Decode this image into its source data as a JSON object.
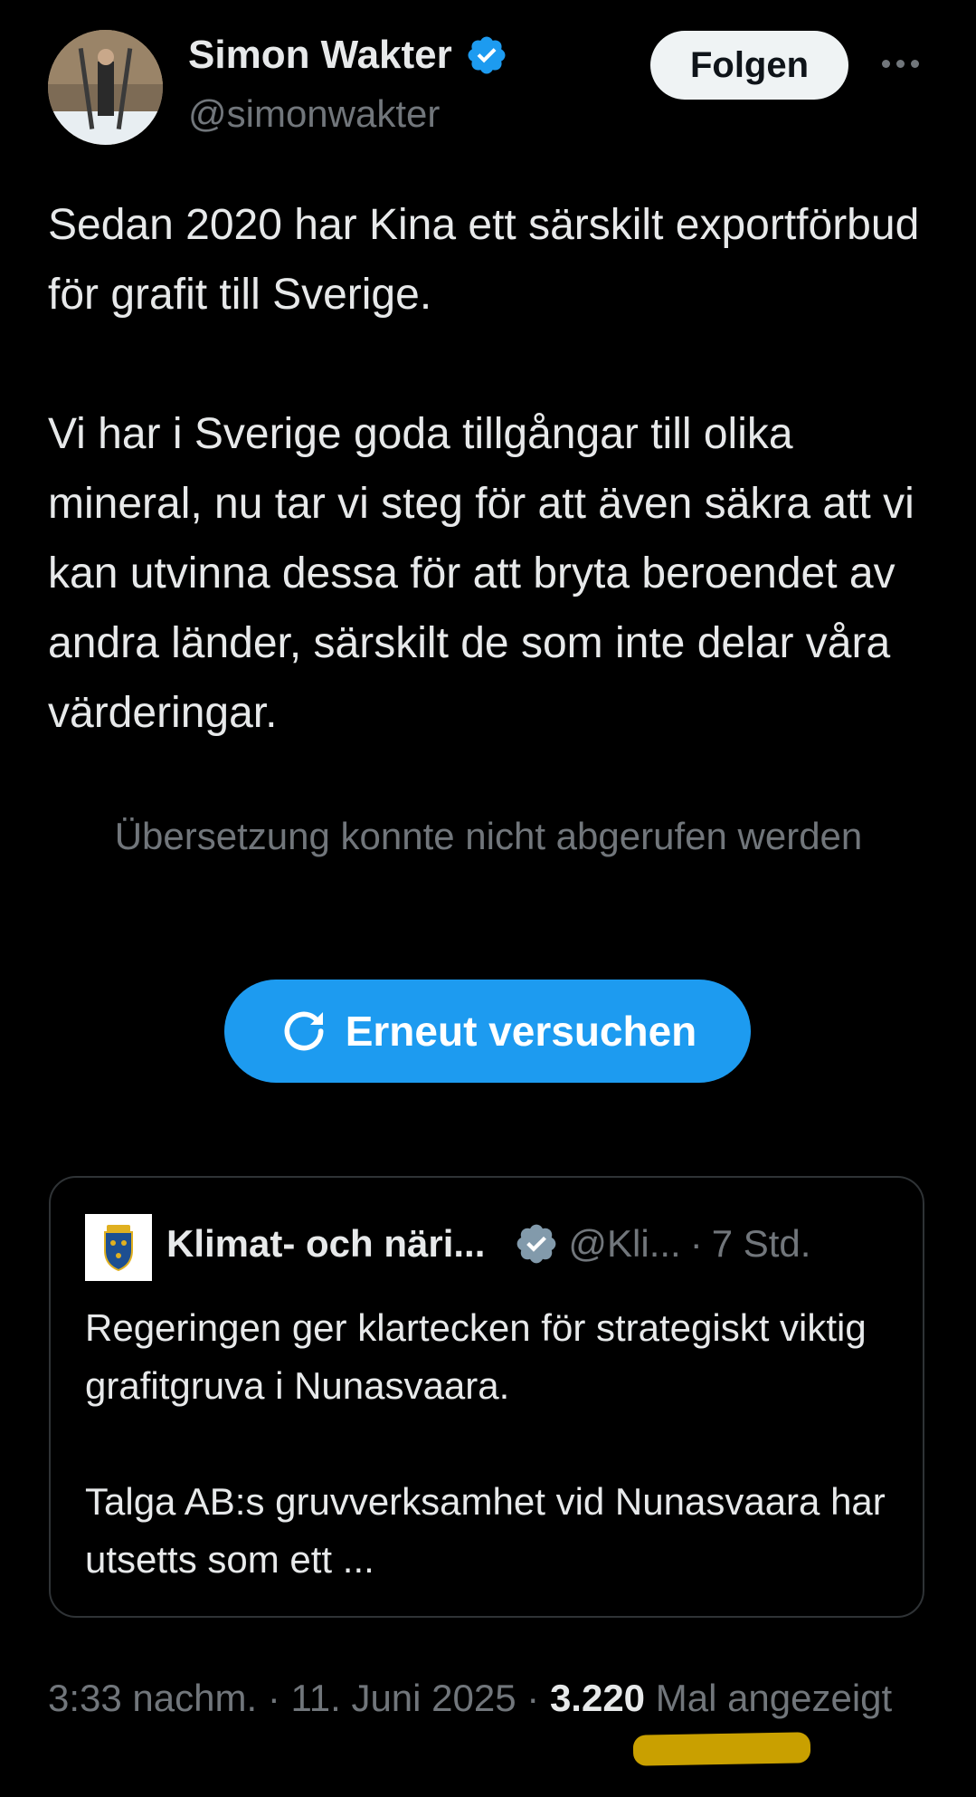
{
  "author": {
    "name": "Simon Wakter",
    "handle": "@simonwakter",
    "follow_label": "Folgen"
  },
  "tweet": {
    "paragraphs": [
      "Sedan 2020 har Kina ett särskilt exportförbud för grafit till Sverige.",
      "Vi har i Sverige goda tillgångar till olika mineral, nu tar vi steg för att även säkra att vi kan utvinna dessa för att bryta beroendet av andra länder, särskilt de som inte delar våra värderingar."
    ]
  },
  "translation": {
    "error": "Übersetzung konnte nicht abgerufen werden",
    "retry_label": "Erneut versuchen"
  },
  "quote": {
    "name": "Klimat- och näri...",
    "handle": "@Kli...",
    "separator": "·",
    "time": "7 Std.",
    "paragraphs": [
      "Regeringen ger klartecken för strategiskt viktig grafitgruva i Nunasvaara.",
      "Talga AB:s gruvverksamhet vid Nunasvaara har utsetts som ett ..."
    ]
  },
  "meta": {
    "time": "3:33 nachm.",
    "separator": "·",
    "date": "11. Juni 2025",
    "views_count": "3.220",
    "views_label": "Mal angezeigt"
  },
  "colors": {
    "background": "#000000",
    "accent": "#1d9bf0",
    "verified": "#1d9bf0",
    "gov_verified": "#829aab",
    "muted": "#71767b",
    "highlight": "#c9a000"
  }
}
